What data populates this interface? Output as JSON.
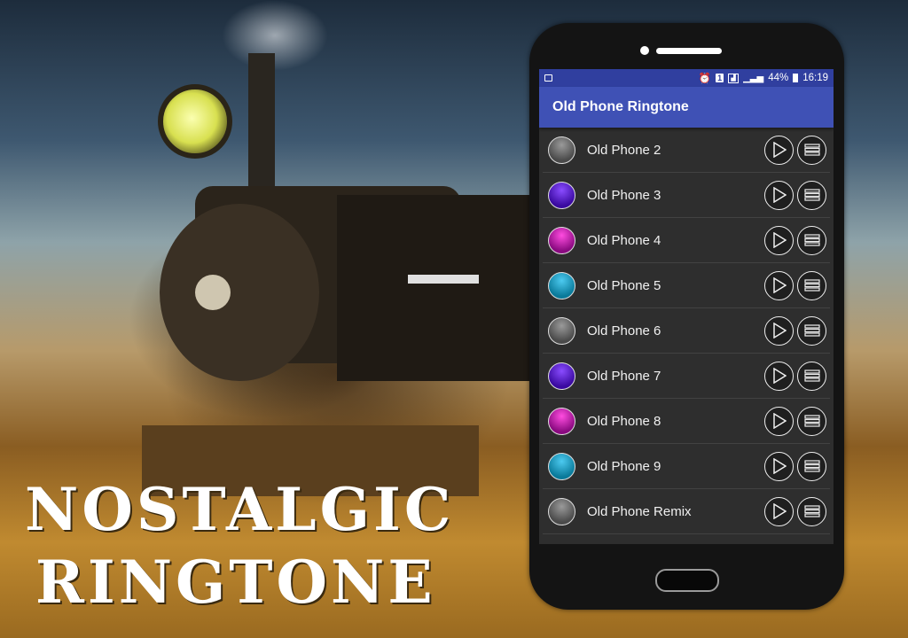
{
  "promo": {
    "line1": "NOSTALGIC",
    "line2": "RINGTONE"
  },
  "status_bar": {
    "battery": "44%",
    "time": "16:19",
    "sim": "1"
  },
  "app": {
    "title": "Old Phone Ringtone",
    "accent": "#3f51b5",
    "status_color": "#303f9f"
  },
  "ringtones": [
    {
      "label": "Old Phone 2",
      "color": "gray"
    },
    {
      "label": "Old Phone 3",
      "color": "purple"
    },
    {
      "label": "Old Phone 4",
      "color": "magenta"
    },
    {
      "label": "Old Phone 5",
      "color": "cyan"
    },
    {
      "label": "Old Phone 6",
      "color": "gray"
    },
    {
      "label": "Old Phone 7",
      "color": "purple"
    },
    {
      "label": "Old Phone 8",
      "color": "magenta"
    },
    {
      "label": "Old Phone 9",
      "color": "cyan"
    },
    {
      "label": "Old Phone Remix",
      "color": "gray"
    }
  ],
  "icons": {
    "play": "play-icon",
    "menu": "menu-icon"
  }
}
